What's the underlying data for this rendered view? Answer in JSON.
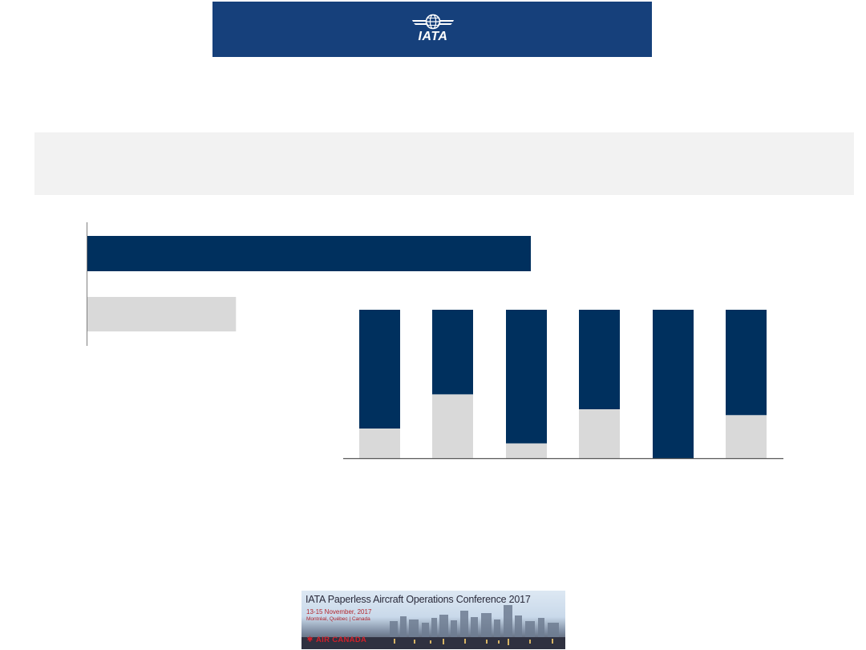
{
  "header": {
    "logo_text": "IATA",
    "logo_icon": "globe-wings-icon",
    "banner_color": "#16407b"
  },
  "colors": {
    "navy": "#00305e",
    "grey": "#d9d9d9",
    "band": "#f2f2f2"
  },
  "chart_data": [
    {
      "type": "bar",
      "orientation": "horizontal",
      "values": [
        100,
        33.5
      ],
      "series_colors": [
        "#00305e",
        "#d9d9d9"
      ],
      "xlim": [
        0,
        100
      ],
      "legend": "none",
      "grid": false
    },
    {
      "type": "bar",
      "orientation": "vertical",
      "stacked": true,
      "series": [
        {
          "values": [
            20,
            43,
            10,
            33,
            0,
            29
          ],
          "color": "#d9d9d9"
        },
        {
          "values": [
            80,
            57,
            90,
            67,
            100,
            71
          ],
          "color": "#00305e"
        }
      ],
      "ylim": [
        0,
        100
      ],
      "legend": "none",
      "grid": false
    }
  ],
  "conference": {
    "title": "IATA Paperless Aircraft Operations Conference 2017",
    "dates": "13-15 November, 2017",
    "location": "Montréal, Québec | Canada",
    "brand": "AIR CANADA",
    "brand_icon": "maple-leaf-icon"
  }
}
